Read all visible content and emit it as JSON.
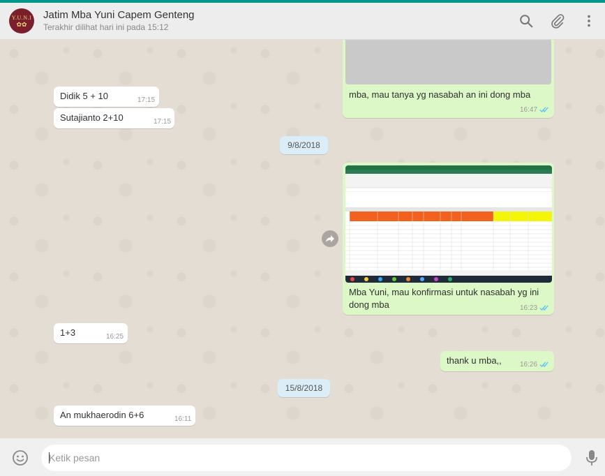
{
  "header": {
    "avatar_line1": "Y.U.N.I",
    "avatar_line2": "✿✿",
    "contact_name": "Jatim Mba Yuni Capem Genteng",
    "status": "Terakhir dilihat hari ini pada 15:12",
    "icons": [
      "search-icon",
      "attach-icon",
      "menu-icon"
    ]
  },
  "messages": [
    {
      "dir": "out",
      "text": "mba, mau tanya yg nasabah an ini dong mba",
      "time": "16:47",
      "read": true
    },
    {
      "dir": "in",
      "text": "Didik 5 + 10",
      "time": "17:15"
    },
    {
      "dir": "in",
      "text": "Sutajianto 2+10",
      "time": "17:15"
    },
    {
      "dir": "date",
      "text": "9/8/2018"
    },
    {
      "dir": "out",
      "type": "image",
      "text_line1": "Mba Yuni, mau konfirmasi untuk nasabah yg ini",
      "text_line2": "dong mba",
      "time": "16:23",
      "read": true
    },
    {
      "dir": "in",
      "text": "1+3",
      "time": "16:25"
    },
    {
      "dir": "out",
      "text": "thank u mba,,",
      "time": "16:26",
      "read": true
    },
    {
      "dir": "date",
      "text": "15/8/2018"
    },
    {
      "dir": "in",
      "text": "An mukhaerodin 6+6",
      "time": "16:11"
    }
  ],
  "composer": {
    "placeholder": "Ketik pesan",
    "icons": [
      "emoji-icon",
      "mic-icon"
    ]
  },
  "colors": {
    "accent": "#009688",
    "outgoing_bubble": "#dcf8c6",
    "incoming_bubble": "#ffffff",
    "read_ticks": "#4fc3f7",
    "date_chip": "#dbeef7"
  }
}
